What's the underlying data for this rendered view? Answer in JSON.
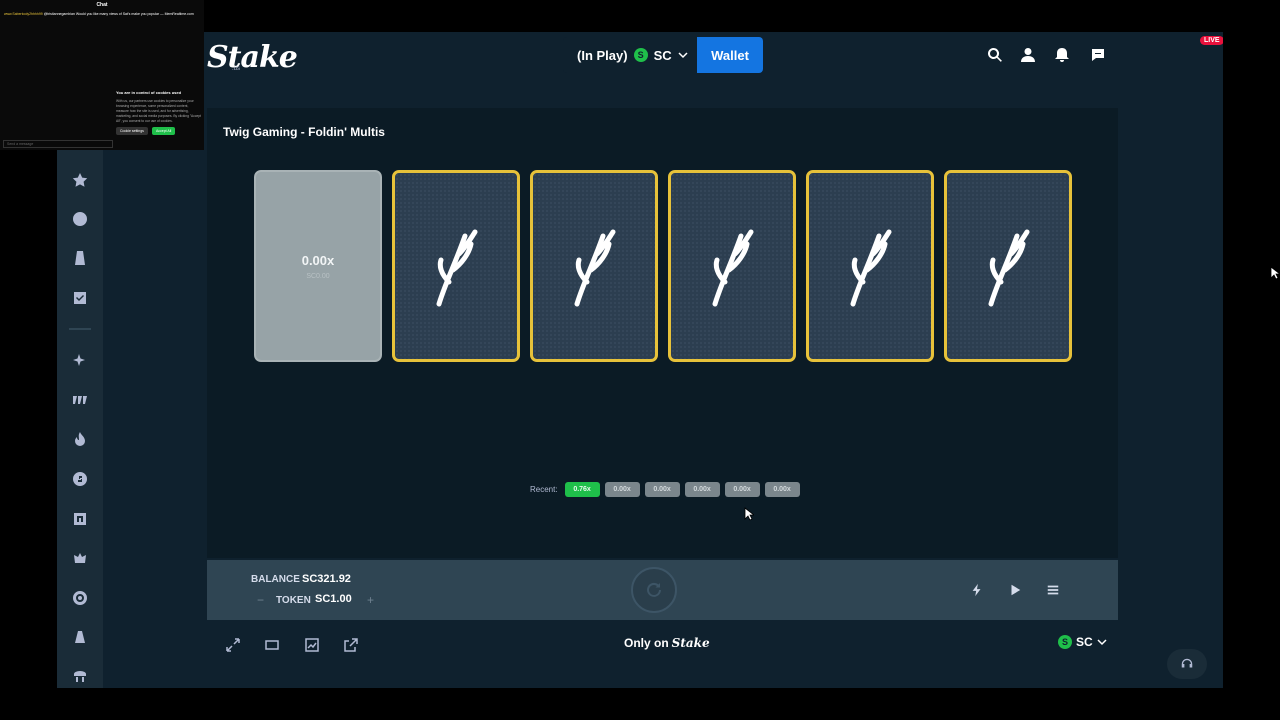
{
  "header": {
    "logo": "Stake",
    "logo_sub": ".us",
    "balance_status": "(In Play)",
    "currency_symbol": "S",
    "currency": "SC",
    "wallet_label": "Wallet",
    "live_badge": "LIVE"
  },
  "sidebar": {
    "icons": [
      "star-icon",
      "clock-icon",
      "trophy-icon",
      "coupon-icon",
      "sparkle-icon",
      "slots-icon",
      "fire-icon",
      "dice-icon",
      "badge-icon",
      "flame-icon",
      "target-icon",
      "podium-icon",
      "table-icon"
    ]
  },
  "game": {
    "title": "Twig Gaming - Foldin' Multis",
    "revealed_card": {
      "multiplier": "0.00x",
      "sub": "SC0.00"
    },
    "hidden_cards_count": 5,
    "recent_label": "Recent:",
    "recent": [
      {
        "value": "0.76x",
        "win": true
      },
      {
        "value": "0.00x",
        "win": false
      },
      {
        "value": "0.00x",
        "win": false
      },
      {
        "value": "0.00x",
        "win": false
      },
      {
        "value": "0.00x",
        "win": false
      },
      {
        "value": "0.00x",
        "win": false
      }
    ]
  },
  "controls": {
    "balance_label": "BALANCE",
    "balance_value": "SC321.92",
    "token_label": "TOKEN",
    "token_value": "SC1.00",
    "minus": "−",
    "plus": "+"
  },
  "footer": {
    "only_on": "Only on",
    "only_on_brand": "Stake",
    "currency_symbol": "S",
    "currency": "SC"
  },
  "chat": {
    "title": "Chat",
    "line_user": "www.Sabertooly2hhhh99",
    "line_msg": "@tristiannegambian Would you like many views of Sat's make you popular — MemRealtime.com",
    "cookie_title": "You are in control of cookies used",
    "cookie_text": "With us, our partners use cookies to personalize your browsing experience, some personalized content, measure how the site is used, and for advertising, marketing, and social media purposes. By clicking \"Accept All\", you consent to our use of cookies.",
    "cookie_settings": "Cookie settings",
    "cookie_accept": "Accept All",
    "input_placeholder": "Send a message"
  },
  "colors": {
    "accent": "#1475e1",
    "card_border": "#e7c23a",
    "win": "#1fbf4a",
    "panel": "#0b1b25"
  }
}
